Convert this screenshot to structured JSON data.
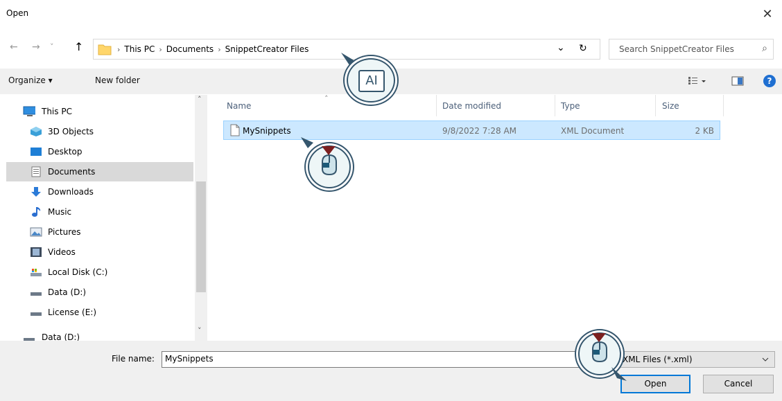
{
  "window": {
    "title": "Open",
    "close_glyph": "✕"
  },
  "nav": {
    "back_glyph": "←",
    "forward_glyph": "→",
    "recent_glyph": "˅",
    "up_glyph": "↑",
    "breadcrumb": [
      "This PC",
      "Documents",
      "SnippetCreator Files"
    ],
    "separator": "›",
    "dropdown_glyph": "⌄",
    "refresh_glyph": "↻"
  },
  "search": {
    "placeholder": "Search SnippetCreator Files",
    "icon_glyph": "⌕"
  },
  "toolbar": {
    "organize_label": "Organize ▾",
    "new_folder_label": "New folder",
    "help_glyph": "?"
  },
  "sidebar": {
    "items": [
      {
        "label": "This PC",
        "icon": "pc-icon"
      },
      {
        "label": "3D Objects",
        "icon": "cube-icon"
      },
      {
        "label": "Desktop",
        "icon": "desktop-icon"
      },
      {
        "label": "Documents",
        "icon": "documents-icon",
        "selected": true
      },
      {
        "label": "Downloads",
        "icon": "download-icon"
      },
      {
        "label": "Music",
        "icon": "music-icon"
      },
      {
        "label": "Pictures",
        "icon": "pictures-icon"
      },
      {
        "label": "Videos",
        "icon": "videos-icon"
      },
      {
        "label": "Local Disk (C:)",
        "icon": "disk-icon"
      },
      {
        "label": "Data (D:)",
        "icon": "drive-icon"
      },
      {
        "label": "License (E:)",
        "icon": "drive-icon"
      },
      {
        "label": "Data (D:)",
        "icon": "drive-icon"
      }
    ],
    "scroll_up_glyph": "˄",
    "scroll_down_glyph": "˅"
  },
  "file_list": {
    "columns": [
      "Name",
      "Date modified",
      "Type",
      "Size"
    ],
    "sort_glyph": "˄",
    "rows": [
      {
        "name": "MySnippets",
        "date": "9/8/2022 7:28 AM",
        "type": "XML Document",
        "size": "2 KB"
      }
    ]
  },
  "footer": {
    "filename_label": "File name:",
    "filename_value": "MySnippets",
    "filter_value": "XML Files (*.xml)",
    "open_label": "Open",
    "cancel_label": "Cancel"
  },
  "overlay": {
    "text_cursor_label": "AI"
  },
  "colors": {
    "selection": "#cce8ff",
    "accent": "#0078d7",
    "callout": "#35566d",
    "mouse_marker": "#7b1f1f"
  }
}
